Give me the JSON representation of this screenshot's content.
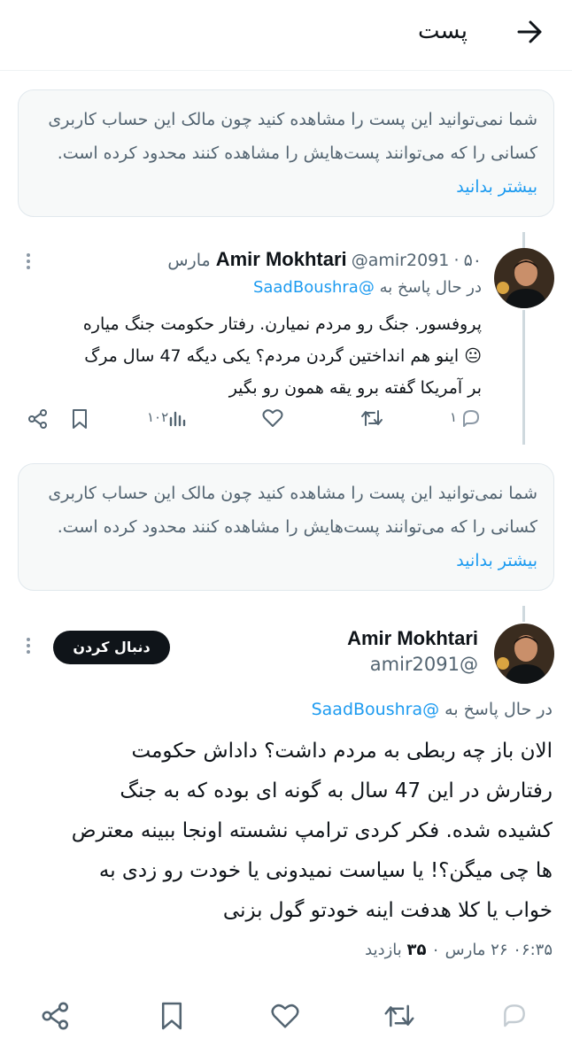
{
  "header": {
    "title": "پست"
  },
  "notice1": {
    "text": "شما نمی‌توانید این پست را مشاهده کنید چون مالک این حساب کاربری کسانی را که می‌توانند پست‌هایش را مشاهده کنند محدود کرده است.",
    "link": "بیشتر بدانید"
  },
  "reply_tweet": {
    "name": "Amir Mokhtari",
    "handle": "@amir2091",
    "separator": "·",
    "date": "۵۰ مارس",
    "replying_prefix": "در حال پاسخ به",
    "replying_to": "@SaadBoushra",
    "lines": [
      "پروفسور. جنگ رو مردم نمیارن. رفتار حکومت جنگ میاره",
      "😐 اینو هم انداختین گردن مردم؟  یکی دیگه 47 سال مرگ",
      "بر آمریکا گفته برو یقه همون رو بگیر"
    ],
    "reply_count": "۱",
    "views_count": "۱۰۲"
  },
  "notice2": {
    "text": "شما نمی‌توانید این پست را مشاهده کنید چون مالک این حساب کاربری کسانی را که می‌توانند پست‌هایش را مشاهده کنند محدود کرده است.",
    "link": "بیشتر بدانید"
  },
  "main_tweet": {
    "name": "Amir Mokhtari",
    "handle": "@amir2091",
    "follow_label": "دنبال کردن",
    "replying_prefix": "در حال پاسخ به",
    "replying_to": "@SaadBoushra",
    "lines": [
      "الان باز چه ربطی به مردم داشت؟ داداش حکومت",
      "رفتارش در این 47 سال به گونه ای بوده که به جنگ",
      "کشیده شده. فکر کردی ترامپ نشسته اونجا ببینه معترض",
      "ها چی میگن؟! یا سیاست نمیدونی یا خودت رو زدی به",
      "خواب یا کلا هدفت اینه خودتو گول بزنی"
    ],
    "time": "۰۶:۳۵",
    "date": "۲۶ مارس ۰",
    "views_count": "۳۵",
    "views_label": "بازدید"
  },
  "icons": {
    "back": "arrow-right-icon",
    "more": "more-vertical-icon",
    "reply": "reply-bubble-icon",
    "retweet": "retweet-icon",
    "like": "heart-icon",
    "views": "views-bar-icon",
    "bookmark": "bookmark-icon",
    "share": "share-icon"
  }
}
